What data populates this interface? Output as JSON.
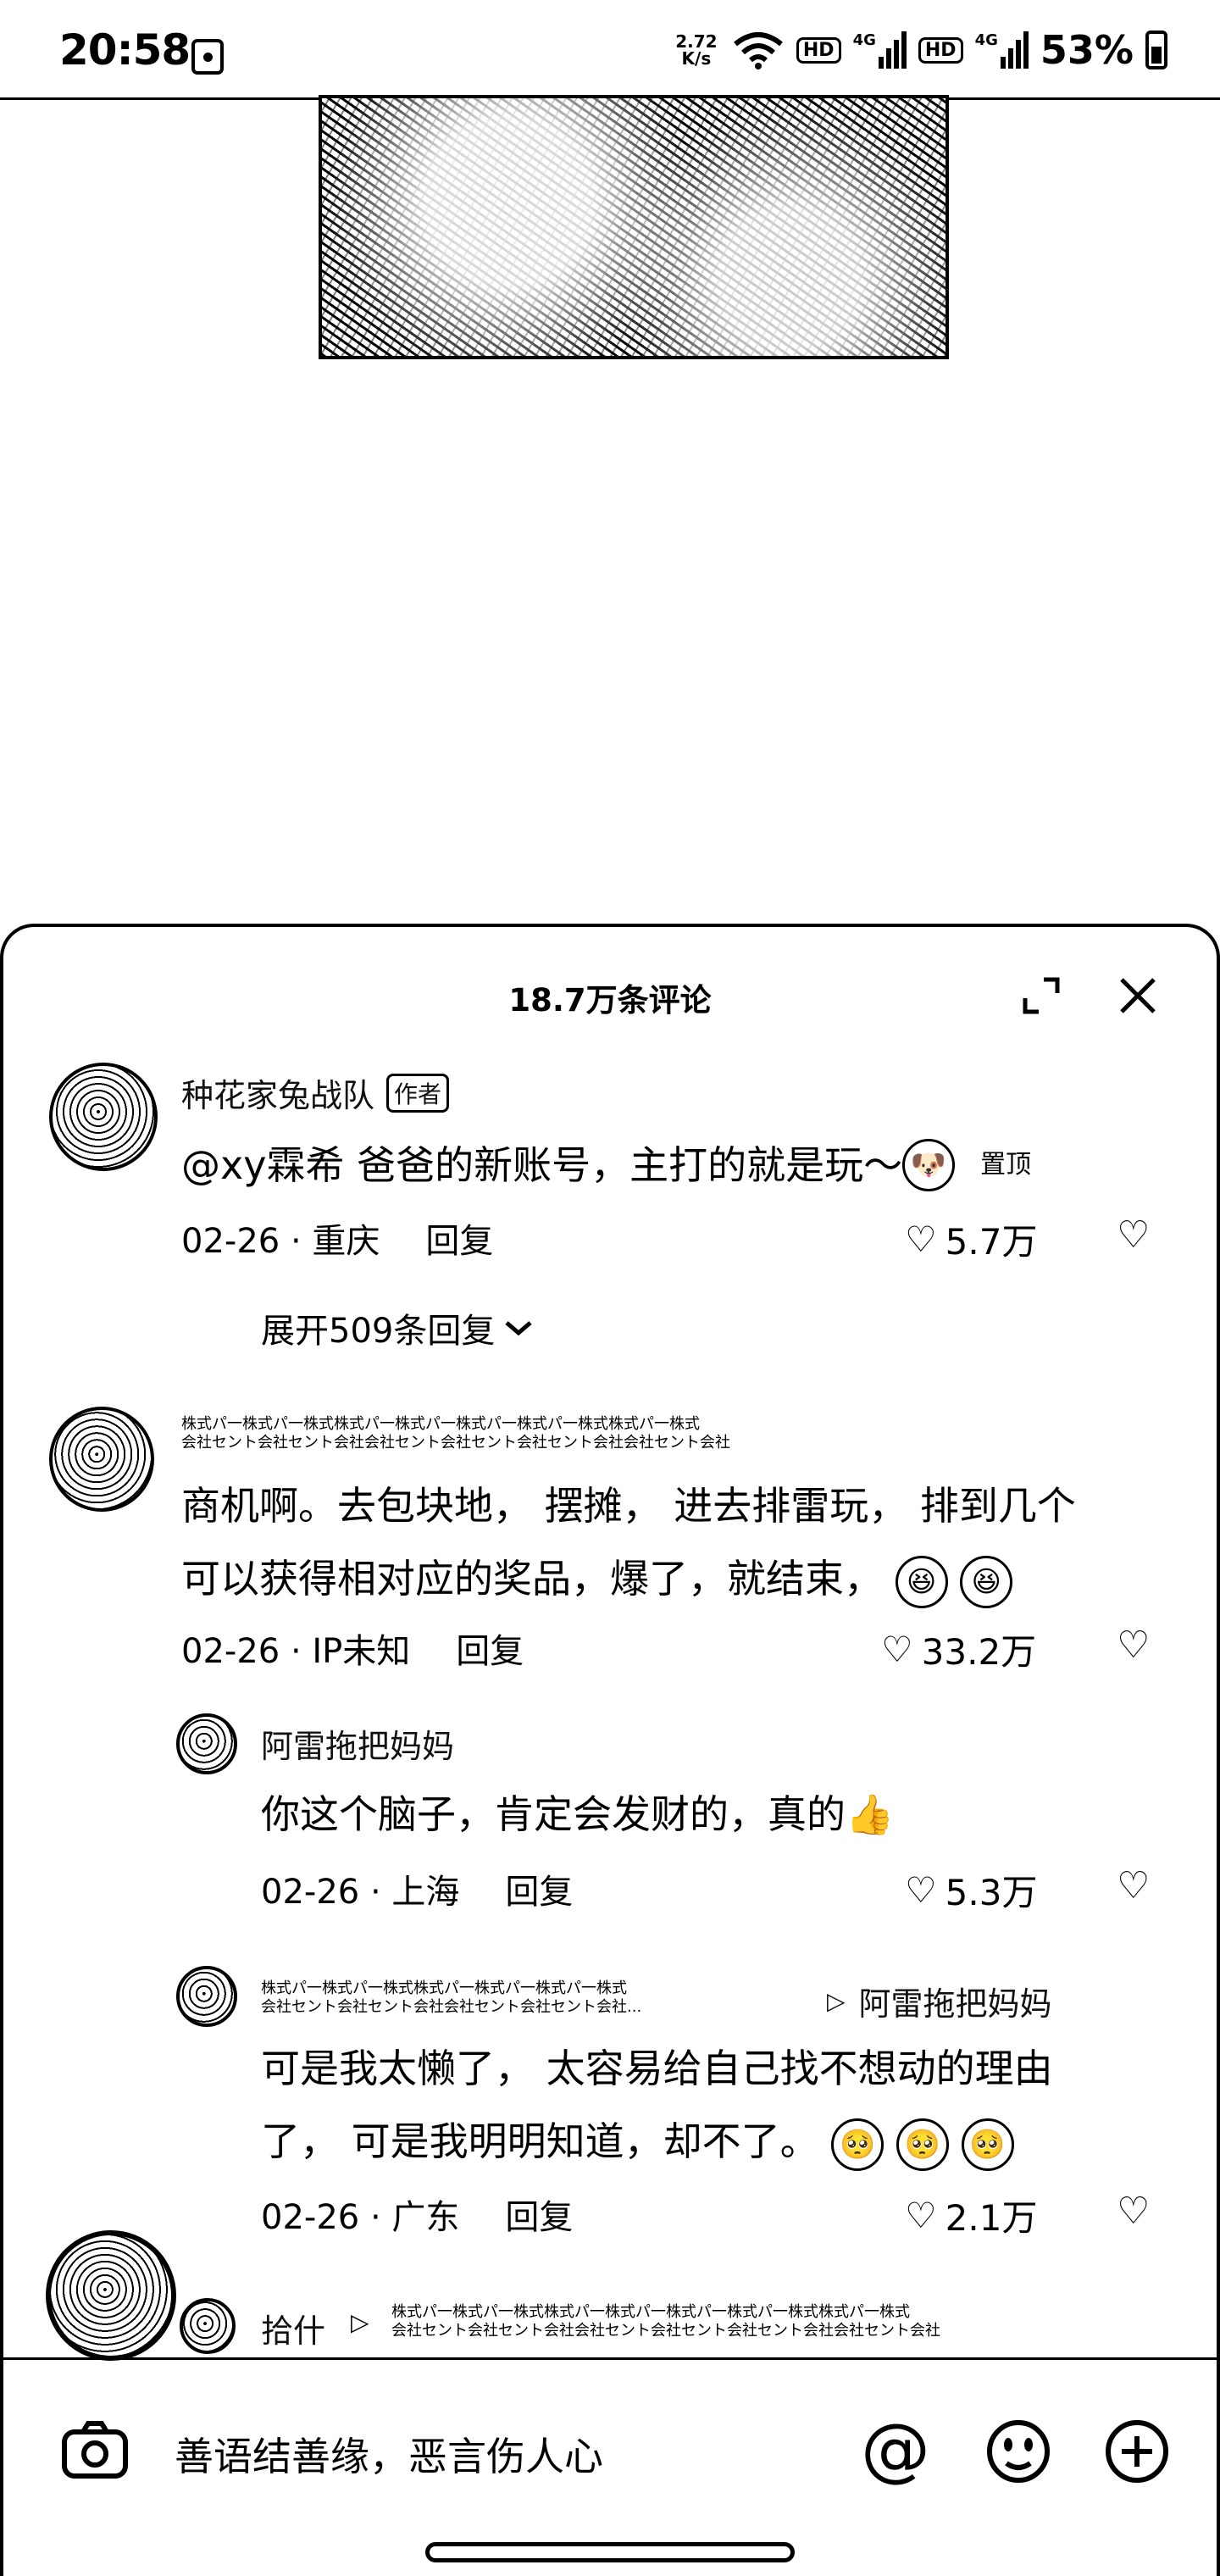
{
  "status_bar": {
    "time": "20:58",
    "net_speed_top": "2.72",
    "net_speed_bottom": "K/s",
    "hd1": "HD",
    "sig1": "4G",
    "hd2": "HD",
    "sig2": "4G",
    "battery": "53%"
  },
  "comments_sheet": {
    "title": "18.7万条评论",
    "comments": [
      {
        "user": "种花家兔战队",
        "badge": "作者",
        "text": "@xy霖希 爸爸的新账号，主打的就是玩～",
        "pinned": "置顶",
        "date": "02-26 · 重庆",
        "reply": "回复",
        "likes": "5.7万",
        "expand": "展开509条回复"
      },
      {
        "user_line1": "株式パ一株式パ一株式株式パ一株式パ一株式パ一株式パ一株式株式パ一株式",
        "user_line2": "会社セント会社セント会社会社セント会社セント会社セント会社会社セント会社",
        "text_line1": "商机啊。去包块地， 摆摊， 进去排雷玩， 排到几个",
        "text_line2": "可以获得相对应的奖品，爆了，就结束，",
        "date": "02-26 · IP未知",
        "reply": "回复",
        "likes": "33.2万"
      }
    ],
    "replies": [
      {
        "user": "阿雷拖把妈妈",
        "text": "你这个脑子，肯定会发财的，真的",
        "date": "02-26 · 上海",
        "reply": "回复",
        "likes": "5.3万"
      },
      {
        "user_line1": "株式パ一株式パ一株式株式パ一株式パ一株式パ一株式",
        "user_line2": "会社セント会社セント会社会社セント会社セント会社...",
        "reply_to": "阿雷拖把妈妈",
        "text_line1": "可是我太懒了， 太容易给自己找不想动的理由",
        "text_line2": "了， 可是我明明知道，却不了。",
        "date": "02-26 · 广东",
        "reply": "回复",
        "likes": "2.1万"
      },
      {
        "user": "拾什",
        "reply_to_line1": "株式パ一株式パ一株式株式パ一株式パ一株式パ一株式パ一株式株式パ一株式",
        "reply_to_line2": "会社セント会社セント会社会社セント会社セント会社セント会社会社セント会社"
      }
    ]
  },
  "input_bar": {
    "placeholder": "善语结善缘，恶言伤人心"
  }
}
